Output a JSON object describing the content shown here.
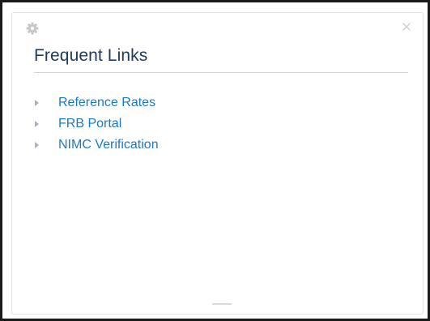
{
  "widget": {
    "title": "Frequent Links",
    "settings_icon": "gear-icon",
    "close_icon": "close-icon",
    "close_label": "×"
  },
  "links": [
    {
      "label": "Reference Rates",
      "icon": "triangle-right-icon"
    },
    {
      "label": "FRB Portal",
      "icon": "triangle-right-icon"
    },
    {
      "label": "NIMC Verification",
      "icon": "triangle-right-icon"
    }
  ],
  "colors": {
    "title": "#1f3a5a",
    "link": "#1b78c9",
    "arrow": "#a8b3bf",
    "icon": "#c7c7c7"
  }
}
